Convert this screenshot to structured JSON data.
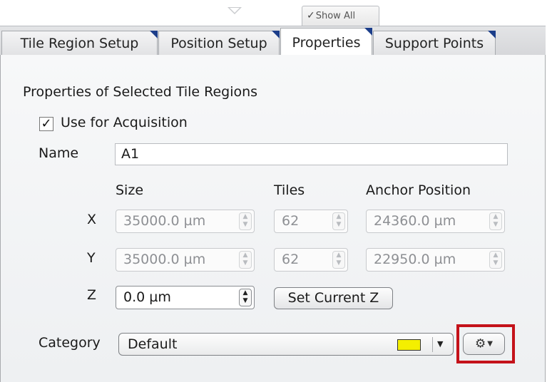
{
  "toolbar": {
    "show_all_label": "Show All",
    "show_all_check": "✓"
  },
  "tabs": [
    {
      "label": "Tile Region Setup",
      "active": false
    },
    {
      "label": "Position Setup",
      "active": false
    },
    {
      "label": "Properties",
      "active": true
    },
    {
      "label": "Support Points",
      "active": false
    }
  ],
  "properties": {
    "heading": "Properties of Selected Tile Regions",
    "use_for_acquisition": {
      "label": "Use for Acquisition",
      "checked": true,
      "mark": "✓"
    },
    "name": {
      "label": "Name",
      "value": "A1"
    },
    "columns": {
      "size": "Size",
      "tiles": "Tiles",
      "anchor": "Anchor Position"
    },
    "rows": [
      {
        "axis": "X",
        "size": "35000.0 µm",
        "tiles": "62",
        "anchor": "24360.0 µm"
      },
      {
        "axis": "Y",
        "size": "35000.0 µm",
        "tiles": "62",
        "anchor": "22950.0 µm"
      }
    ],
    "z": {
      "axis": "Z",
      "value": "0.0 µm",
      "set_current_label": "Set Current Z"
    },
    "category": {
      "label": "Category",
      "value": "Default",
      "color": "#f4ef00"
    }
  },
  "options_button": {
    "icon": "gear-icon",
    "highlight_color": "#c4121a"
  }
}
